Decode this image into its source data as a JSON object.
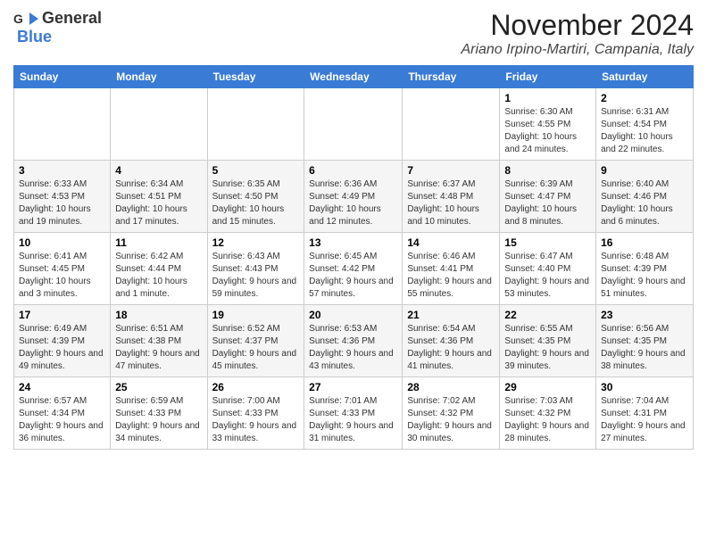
{
  "logo": {
    "general": "General",
    "blue": "Blue"
  },
  "title": "November 2024",
  "location": "Ariano Irpino-Martiri, Campania, Italy",
  "weekdays": [
    "Sunday",
    "Monday",
    "Tuesday",
    "Wednesday",
    "Thursday",
    "Friday",
    "Saturday"
  ],
  "weeks": [
    [
      {
        "day": "",
        "info": ""
      },
      {
        "day": "",
        "info": ""
      },
      {
        "day": "",
        "info": ""
      },
      {
        "day": "",
        "info": ""
      },
      {
        "day": "",
        "info": ""
      },
      {
        "day": "1",
        "info": "Sunrise: 6:30 AM\nSunset: 4:55 PM\nDaylight: 10 hours and 24 minutes."
      },
      {
        "day": "2",
        "info": "Sunrise: 6:31 AM\nSunset: 4:54 PM\nDaylight: 10 hours and 22 minutes."
      }
    ],
    [
      {
        "day": "3",
        "info": "Sunrise: 6:33 AM\nSunset: 4:53 PM\nDaylight: 10 hours and 19 minutes."
      },
      {
        "day": "4",
        "info": "Sunrise: 6:34 AM\nSunset: 4:51 PM\nDaylight: 10 hours and 17 minutes."
      },
      {
        "day": "5",
        "info": "Sunrise: 6:35 AM\nSunset: 4:50 PM\nDaylight: 10 hours and 15 minutes."
      },
      {
        "day": "6",
        "info": "Sunrise: 6:36 AM\nSunset: 4:49 PM\nDaylight: 10 hours and 12 minutes."
      },
      {
        "day": "7",
        "info": "Sunrise: 6:37 AM\nSunset: 4:48 PM\nDaylight: 10 hours and 10 minutes."
      },
      {
        "day": "8",
        "info": "Sunrise: 6:39 AM\nSunset: 4:47 PM\nDaylight: 10 hours and 8 minutes."
      },
      {
        "day": "9",
        "info": "Sunrise: 6:40 AM\nSunset: 4:46 PM\nDaylight: 10 hours and 6 minutes."
      }
    ],
    [
      {
        "day": "10",
        "info": "Sunrise: 6:41 AM\nSunset: 4:45 PM\nDaylight: 10 hours and 3 minutes."
      },
      {
        "day": "11",
        "info": "Sunrise: 6:42 AM\nSunset: 4:44 PM\nDaylight: 10 hours and 1 minute."
      },
      {
        "day": "12",
        "info": "Sunrise: 6:43 AM\nSunset: 4:43 PM\nDaylight: 9 hours and 59 minutes."
      },
      {
        "day": "13",
        "info": "Sunrise: 6:45 AM\nSunset: 4:42 PM\nDaylight: 9 hours and 57 minutes."
      },
      {
        "day": "14",
        "info": "Sunrise: 6:46 AM\nSunset: 4:41 PM\nDaylight: 9 hours and 55 minutes."
      },
      {
        "day": "15",
        "info": "Sunrise: 6:47 AM\nSunset: 4:40 PM\nDaylight: 9 hours and 53 minutes."
      },
      {
        "day": "16",
        "info": "Sunrise: 6:48 AM\nSunset: 4:39 PM\nDaylight: 9 hours and 51 minutes."
      }
    ],
    [
      {
        "day": "17",
        "info": "Sunrise: 6:49 AM\nSunset: 4:39 PM\nDaylight: 9 hours and 49 minutes."
      },
      {
        "day": "18",
        "info": "Sunrise: 6:51 AM\nSunset: 4:38 PM\nDaylight: 9 hours and 47 minutes."
      },
      {
        "day": "19",
        "info": "Sunrise: 6:52 AM\nSunset: 4:37 PM\nDaylight: 9 hours and 45 minutes."
      },
      {
        "day": "20",
        "info": "Sunrise: 6:53 AM\nSunset: 4:36 PM\nDaylight: 9 hours and 43 minutes."
      },
      {
        "day": "21",
        "info": "Sunrise: 6:54 AM\nSunset: 4:36 PM\nDaylight: 9 hours and 41 minutes."
      },
      {
        "day": "22",
        "info": "Sunrise: 6:55 AM\nSunset: 4:35 PM\nDaylight: 9 hours and 39 minutes."
      },
      {
        "day": "23",
        "info": "Sunrise: 6:56 AM\nSunset: 4:35 PM\nDaylight: 9 hours and 38 minutes."
      }
    ],
    [
      {
        "day": "24",
        "info": "Sunrise: 6:57 AM\nSunset: 4:34 PM\nDaylight: 9 hours and 36 minutes."
      },
      {
        "day": "25",
        "info": "Sunrise: 6:59 AM\nSunset: 4:33 PM\nDaylight: 9 hours and 34 minutes."
      },
      {
        "day": "26",
        "info": "Sunrise: 7:00 AM\nSunset: 4:33 PM\nDaylight: 9 hours and 33 minutes."
      },
      {
        "day": "27",
        "info": "Sunrise: 7:01 AM\nSunset: 4:33 PM\nDaylight: 9 hours and 31 minutes."
      },
      {
        "day": "28",
        "info": "Sunrise: 7:02 AM\nSunset: 4:32 PM\nDaylight: 9 hours and 30 minutes."
      },
      {
        "day": "29",
        "info": "Sunrise: 7:03 AM\nSunset: 4:32 PM\nDaylight: 9 hours and 28 minutes."
      },
      {
        "day": "30",
        "info": "Sunrise: 7:04 AM\nSunset: 4:31 PM\nDaylight: 9 hours and 27 minutes."
      }
    ]
  ]
}
